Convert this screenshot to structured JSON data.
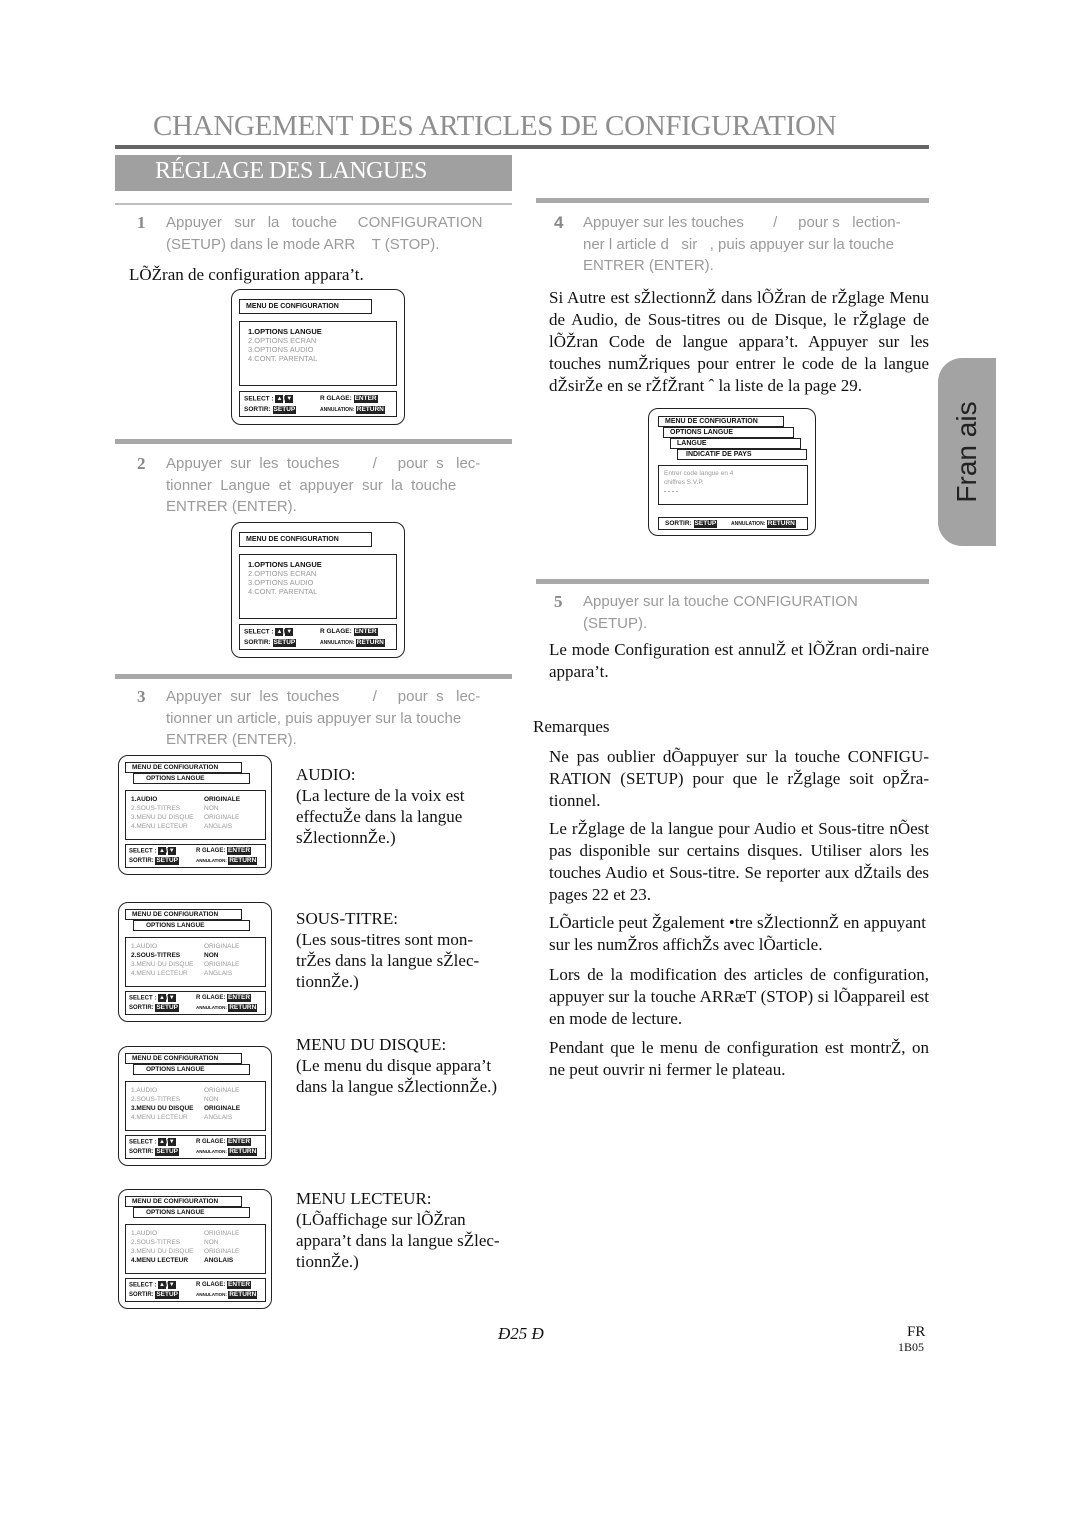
{
  "header": {
    "title": "CHANGEMENT DES ARTICLES DE CONFIGURATION",
    "section": "RÉGLAGE DES LANGUES"
  },
  "side_tab": {
    "label": "Fran   ais"
  },
  "steps": [
    {
      "num": "1",
      "lines": [
        "Appuyer   sur   la   touche     CONFIGURATION",
        "(SETUP) dans le mode ARR    T (STOP)."
      ],
      "after": "LÕŽran de configuration appara’t."
    },
    {
      "num": "2",
      "lines": [
        "Appuyer  sur  les  touches        /     pour  s   lec-",
        "tionner  Langue  et  appuyer  sur  la  touche",
        "ENTRER (ENTER)."
      ]
    },
    {
      "num": "3",
      "lines": [
        "Appuyer  sur  les  touches        /     pour  s   lec-",
        "tionner un article, puis appuyer sur la touche",
        "ENTRER (ENTER)."
      ]
    },
    {
      "num": "4",
      "lines": [
        "Appuyer sur les touches       /     pour s   lection-",
        "ner l article d   sir   , puis appuyer sur la touche",
        "ENTRER (ENTER)."
      ]
    },
    {
      "num": "5",
      "lines": [
        "Appuyer sur la touche CONFIGURATION",
        "(SETUP)."
      ],
      "after": "Le mode Configuration est annulŽ et lÕŽran ordi-naire appara’t."
    }
  ],
  "step4_para": "Si Autre est sŽlectionnŽ dans lÕŽran de rŽglage Menu de Audio, de Sous-titres ou de Disque, le rŽglage de lÕŽran Code de langue appara’t. Appuyer sur les touches numŽriques pour entrer le code de la langue dŽsirŽe en se rŽfŽrant ˆ la liste de la page 29.",
  "main_menu_screen": {
    "title": "MENU DE CONFIGURATION",
    "items": [
      "1.OPTIONS LANGUE",
      "2.OPTIONS ECRAN",
      "3.OPTIONS AUDIO",
      "4.CONT. PARENTAL"
    ],
    "selected": 0
  },
  "footer": {
    "select": "SELECT :",
    "reglage": "R  GLAGE:",
    "enter": "ENTER",
    "sortir": "SORTIR:",
    "setup": "SETUP",
    "annulation": "ANNULATION:",
    "return": "RETURN",
    "up": "▲",
    "down": "▼",
    "slash": "/"
  },
  "lang_screen": {
    "title": "MENU DE CONFIGURATION",
    "subtitle": "OPTIONS LANGUE",
    "items": [
      {
        "label": "1.AUDIO",
        "value": "ORIGINALE"
      },
      {
        "label": "2.SOUS-TITRES",
        "value": "NON"
      },
      {
        "label": "3.MENU DU DISQUE",
        "value": "ORIGINALE"
      },
      {
        "label": "4.MENU LECTEUR",
        "value": "ANGLAIS"
      }
    ]
  },
  "descriptions": [
    {
      "title": "AUDIO:",
      "text": [
        "(La lecture de la voix est",
        "effectuŽe dans la langue",
        "sŽlectionnŽe.)"
      ]
    },
    {
      "title": "SOUS-TITRE:",
      "text": [
        "(Les sous-titres sont mon-",
        "trŽes dans la langue sŽlec-",
        "tionnŽe.)"
      ]
    },
    {
      "title": "MENU DU DISQUE:",
      "text": [
        "(Le menu du disque appara’t",
        "dans la langue sŽlectionnŽe.)"
      ]
    },
    {
      "title": "MENU LECTEUR:",
      "text": [
        "(LÕaffichage sur lÕŽran",
        "appara’t dans la langue sŽlec-",
        "tionnŽe.)"
      ]
    }
  ],
  "code_screen": {
    "labels": [
      "MENU DE CONFIGURATION",
      "OPTIONS LANGUE",
      "LANGUE",
      "INDICATIF DE PAYS"
    ],
    "prompt": [
      "Entrer code langue en 4",
      "chiffres S.V.P."
    ],
    "input": "- - - -"
  },
  "remarks": {
    "title": "Remarques",
    "items": [
      "Ne pas oublier dÕappuyer sur la touche CONFIGU-RATION (SETUP) pour que le rŽglage soit opŽra-tionnel.",
      "Le rŽglage de la langue pour Audio et Sous-titre nÕest pas disponible sur certains disques. Utiliser alors les touches Audio et Sous-titre. Se reporter aux dŽtails des pages 22 et 23.",
      "LÕarticle peut Žgalement •tre sŽlectionnŽ en appuyant sur les numŽros affichŽs avec lÕarticle.",
      "Lors de la modification des articles de configuration, appuyer sur la touche ARRæT (STOP) si lÕappareil est en mode de lecture.",
      "Pendant que le menu de configuration est montrŽ, on ne peut ouvrir ni fermer le plateau."
    ]
  },
  "page_footer": {
    "page": "Ð25 Ð",
    "lang": "FR",
    "code": "1B05"
  }
}
